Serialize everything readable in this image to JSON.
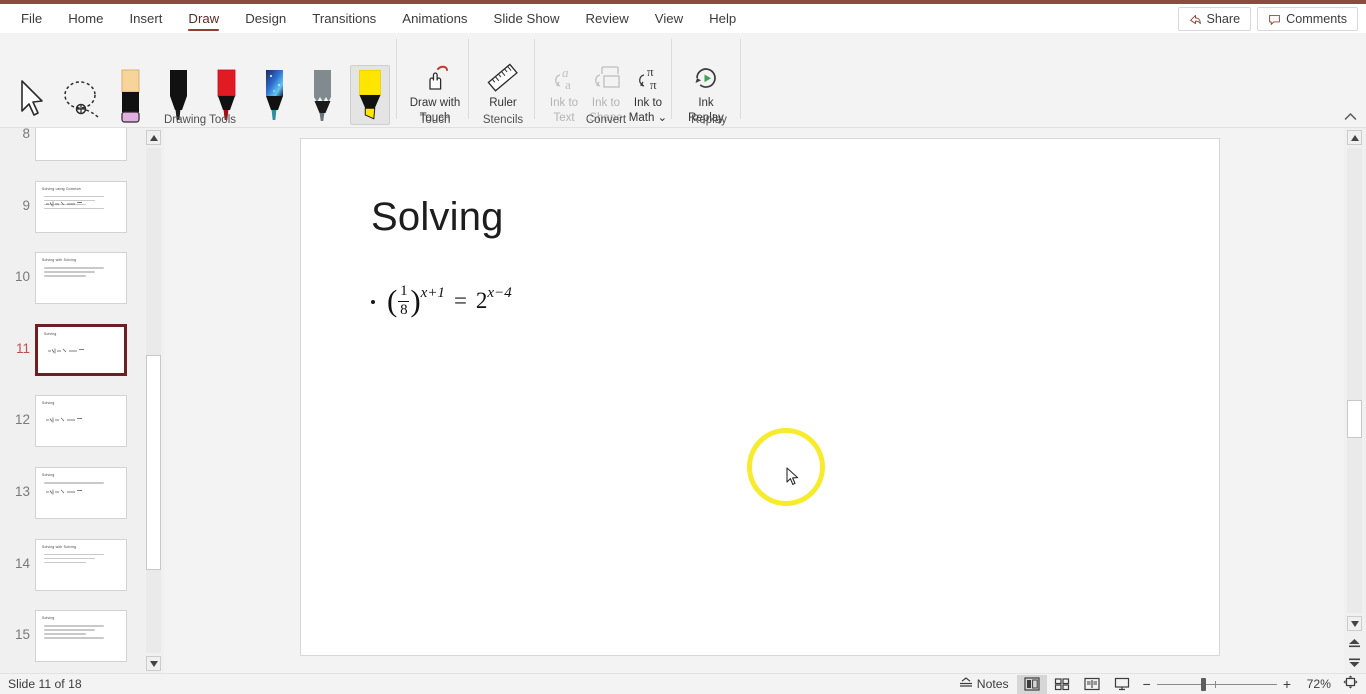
{
  "app": {
    "accent_color": "#8d4a3e",
    "selection_color": "#6e1f23"
  },
  "tabs": [
    {
      "label": "File",
      "active": false
    },
    {
      "label": "Home",
      "active": false
    },
    {
      "label": "Insert",
      "active": false
    },
    {
      "label": "Draw",
      "active": true
    },
    {
      "label": "Design",
      "active": false
    },
    {
      "label": "Transitions",
      "active": false
    },
    {
      "label": "Animations",
      "active": false
    },
    {
      "label": "Slide Show",
      "active": false
    },
    {
      "label": "Review",
      "active": false
    },
    {
      "label": "View",
      "active": false
    },
    {
      "label": "Help",
      "active": false
    }
  ],
  "topright": {
    "share_label": "Share",
    "comments_label": "Comments"
  },
  "ribbon": {
    "groups": [
      {
        "label": "Drawing Tools"
      },
      {
        "label": "Touch"
      },
      {
        "label": "Stencils"
      },
      {
        "label": "Convert"
      },
      {
        "label": "Replay"
      }
    ],
    "drawing_tools": [
      {
        "name": "select-tool",
        "icon": "arrow-pointer-icon"
      },
      {
        "name": "lasso-select-tool",
        "icon": "lasso-icon"
      },
      {
        "name": "eraser-tool",
        "icon": "eraser-icon",
        "color": "#f6d49a"
      },
      {
        "name": "pen-black",
        "icon": "pen-icon",
        "color": "#111111"
      },
      {
        "name": "pen-red",
        "icon": "pen-icon",
        "color": "#e01b24"
      },
      {
        "name": "pen-galaxy",
        "icon": "pen-icon",
        "color": "#2a3a7a"
      },
      {
        "name": "pencil-gray",
        "icon": "pencil-icon",
        "color": "#808a8f"
      },
      {
        "name": "highlighter-yellow",
        "icon": "highlighter-icon",
        "color": "#ffe500",
        "selected": true
      }
    ],
    "buttons": [
      {
        "name": "draw-with-touch",
        "label": "Draw with\nTouch",
        "line1": "Draw with",
        "line2": "Touch",
        "disabled": false
      },
      {
        "name": "ruler",
        "label": "Ruler",
        "line1": "Ruler",
        "line2": "",
        "disabled": false
      },
      {
        "name": "ink-to-text",
        "line1": "Ink to",
        "line2": "Text",
        "disabled": true
      },
      {
        "name": "ink-to-shape",
        "line1": "Ink to",
        "line2": "Shape",
        "disabled": true
      },
      {
        "name": "ink-to-math",
        "line1": "Ink to",
        "line2": "Math ⌄",
        "disabled": false
      },
      {
        "name": "ink-replay",
        "line1": "Ink",
        "line2": "Replay",
        "disabled": false
      }
    ]
  },
  "thumbnails": [
    {
      "number": "8",
      "title": "",
      "lines": 0,
      "current": false
    },
    {
      "number": "9",
      "title": "Solving using Common",
      "lines": 4,
      "current": false
    },
    {
      "number": "10",
      "title": "Solving with Solving",
      "lines": 3,
      "current": false
    },
    {
      "number": "11",
      "title": "Solving",
      "lines": 0,
      "current": true
    },
    {
      "number": "12",
      "title": "Solving",
      "lines": 0,
      "current": false
    },
    {
      "number": "13",
      "title": "Solving",
      "lines": 1,
      "current": false
    },
    {
      "number": "14",
      "title": "Solving with Solving",
      "lines": 3,
      "current": false
    },
    {
      "number": "15",
      "title": "Solving",
      "lines": 4,
      "current": false
    }
  ],
  "slide": {
    "title": "Solving",
    "equation": {
      "open_paren": "(",
      "numerator": "1",
      "denominator": "8",
      "close_paren": ")",
      "left_exponent": "x+1",
      "equals": "=",
      "base": "2",
      "right_exponent": "x−4",
      "plain": "(1/8)^(x+1) = 2^(x-4)"
    },
    "annotation": {
      "name": "highlighter-circle",
      "color": "#f7eb23"
    }
  },
  "status": {
    "slide_indicator": "Slide 11 of 18",
    "notes_label": "Notes",
    "zoom_percent": "72%",
    "views": [
      {
        "name": "normal-view",
        "active": true
      },
      {
        "name": "slide-sorter-view",
        "active": false
      },
      {
        "name": "reading-view",
        "active": false
      },
      {
        "name": "slide-show-view",
        "active": false
      }
    ]
  }
}
